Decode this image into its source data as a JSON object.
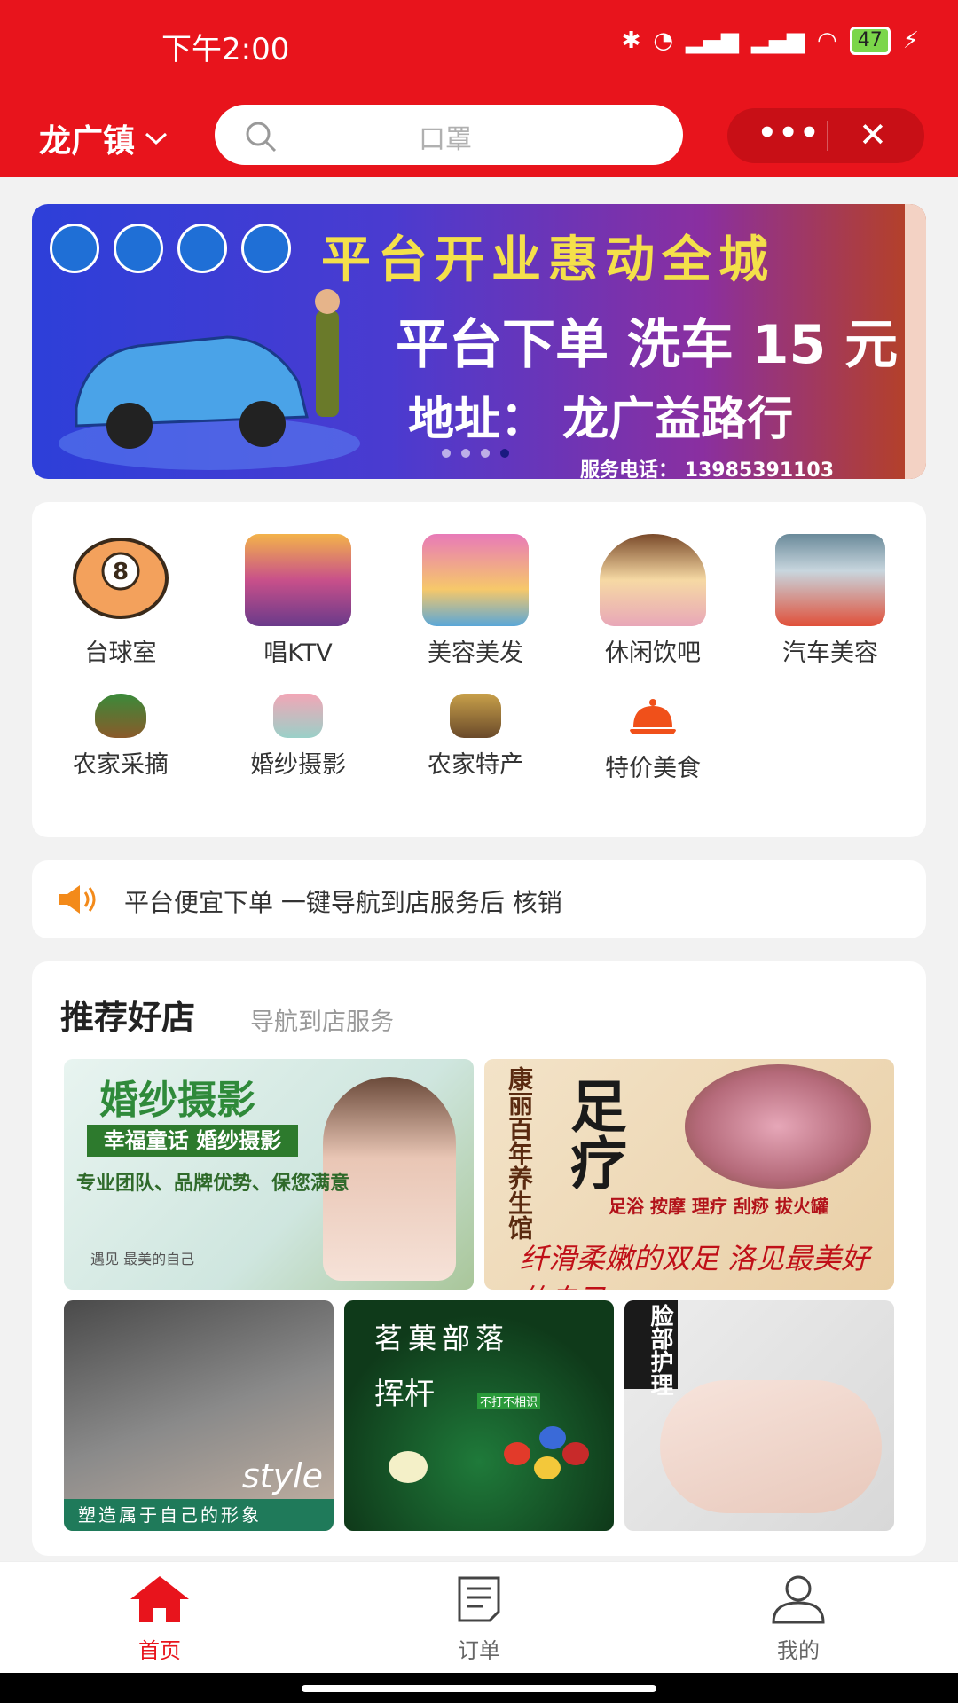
{
  "status_bar": {
    "time": "下午2:00",
    "battery": "47"
  },
  "header": {
    "location": "龙广镇",
    "search_placeholder": "口罩",
    "more_label": "•••",
    "close_label": "✕"
  },
  "banner": {
    "title": "平台开业惠动全城",
    "line1": "平台下单 洗车 15 元",
    "line2": "地址： 龙广益路行",
    "phone": "服务电话： 13985391103"
  },
  "categories": [
    {
      "label": "台球室",
      "icon": "billiard-ball-icon"
    },
    {
      "label": "唱KTV",
      "icon": "ktv-icon"
    },
    {
      "label": "美容美发",
      "icon": "beauty-salon-icon"
    },
    {
      "label": "休闲饮吧",
      "icon": "drink-bar-icon"
    },
    {
      "label": "汽车美容",
      "icon": "car-care-icon"
    },
    {
      "label": "农家采摘",
      "icon": "farm-picking-icon"
    },
    {
      "label": "婚纱摄影",
      "icon": "wedding-photo-icon"
    },
    {
      "label": "农家特产",
      "icon": "farm-produce-icon"
    },
    {
      "label": "特价美食",
      "icon": "food-cloche-icon"
    }
  ],
  "notice": {
    "text": "平台便宜下单 一键导航到店服务后 核销"
  },
  "recommend": {
    "title": "推荐好店",
    "subtitle": "导航到店服务",
    "tiles": {
      "wedding": {
        "heading": "婚纱摄影",
        "bar": "幸福童话 婚纱摄影",
        "line": "专业团队、品牌优势、保您满意",
        "small": "遇见 最美的自己"
      },
      "foot": {
        "vertical": "康丽百年养生馆",
        "big": "足疗",
        "services": "足浴 按摩 理疗 刮痧 拔火罐",
        "slogan": "纤滑柔嫩的双足 洛见最美好的自己"
      },
      "hair": {
        "style": "style",
        "band": "塑造属于自己的形象"
      },
      "billiards": {
        "name": "茗菓部落",
        "slogan": "挥杆",
        "tag": "不打不相识"
      },
      "facial": {
        "vertical": "脸部护理"
      }
    }
  },
  "tabbar": [
    {
      "label": "首页",
      "icon": "home-icon",
      "active": true
    },
    {
      "label": "订单",
      "icon": "order-icon",
      "active": false
    },
    {
      "label": "我的",
      "icon": "user-icon",
      "active": false
    }
  ],
  "colors": {
    "brand": "#e8141c",
    "active_tab": "#e8141c",
    "inactive_tab": "#666666"
  }
}
